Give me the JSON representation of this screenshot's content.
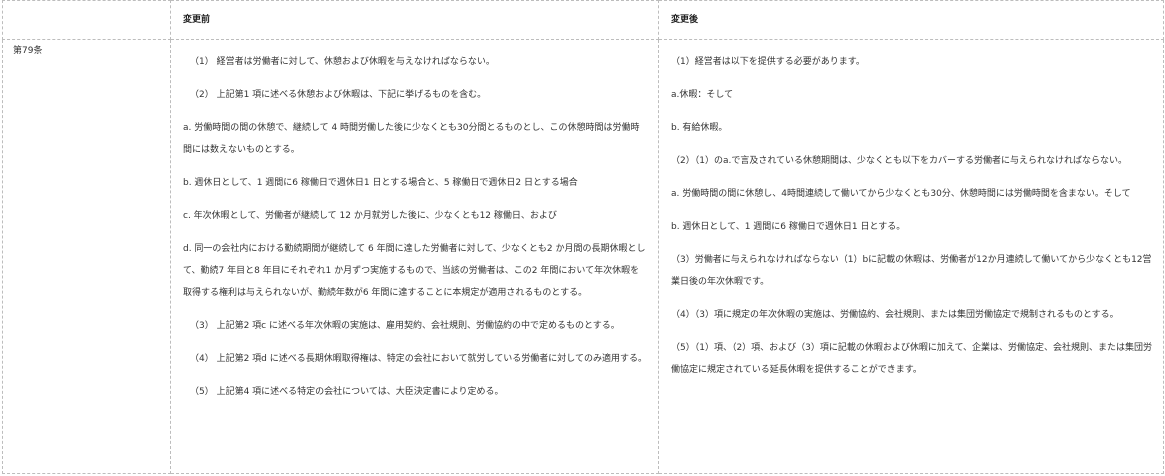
{
  "table": {
    "header": {
      "corner": "",
      "before": "変更前",
      "after": "変更後"
    },
    "article": "第79条",
    "before_paragraphs": [
      "（1） 経営者は労働者に対して、休憩および休暇を与えなければならない。",
      "（2） 上記第1 項に述べる休憩および休暇は、下記に挙げるものを含む。",
      "a. 労働時間の間の休憩で、継続して 4 時間労働した後に少なくとも30分間とるものとし、この休憩時間は労働時間には数えないものとする。",
      "b. 週休日として、1 週間に6 稼働日で週休日1 日とする場合と、5 稼働日で週休日2 日とする場合",
      "c. 年次休暇として、労働者が継続して 12 か月就労した後に、少なくとも12 稼働日、および",
      "d. 同一の会社内における勤続期間が継続して 6 年間に達した労働者に対して、少なくとも2 か月間の長期休暇として、勤続7 年目と8 年目にそれぞれ1 か月ずつ実施するもので、当該の労働者は、この2 年間において年次休暇を取得する権利は与えられないが、勤続年数が6 年間に達することに本規定が適用されるものとする。",
      "（3） 上記第2 項c に述べる年次休暇の実施は、雇用契約、会社規則、労働協約の中で定めるものとする。",
      "（4） 上記第2 項d に述べる長期休暇取得権は、特定の会社において就労している労働者に対してのみ適用する。",
      "（5） 上記第4 項に述べる特定の会社については、大臣決定書により定める。"
    ],
    "after_paragraphs": [
      "（1）経営者は以下を提供する必要があります。",
      "a.休暇：そして",
      "b. 有給休暇。",
      "（2）（1）のa.で言及されている休憩期間は、少なくとも以下をカバーする労働者に与えられなければならない。",
      "a. 労働時間の間に休憩し、4時間連続して働いてから少なくとも30分、休憩時間には労働時間を含まない。そして",
      "b. 週休日として、1 週間に6 稼働日で週休日1 日とする。",
      "（3）労働者に与えられなければならない（1）bに記載の休暇は、労働者が12か月連続して働いてから少なくとも12営業日後の年次休暇です。",
      "（4）（3）項に規定の年次休暇の実施は、労働協約、会社規則、または集団労働協定で規制されるものとする。",
      "（5）（1）項、（2）項、および（3）項に記載の休暇および休暇に加えて、企業は、労働協定、会社規則、または集団労働協定に規定されている延長休暇を提供することができます。"
    ]
  }
}
